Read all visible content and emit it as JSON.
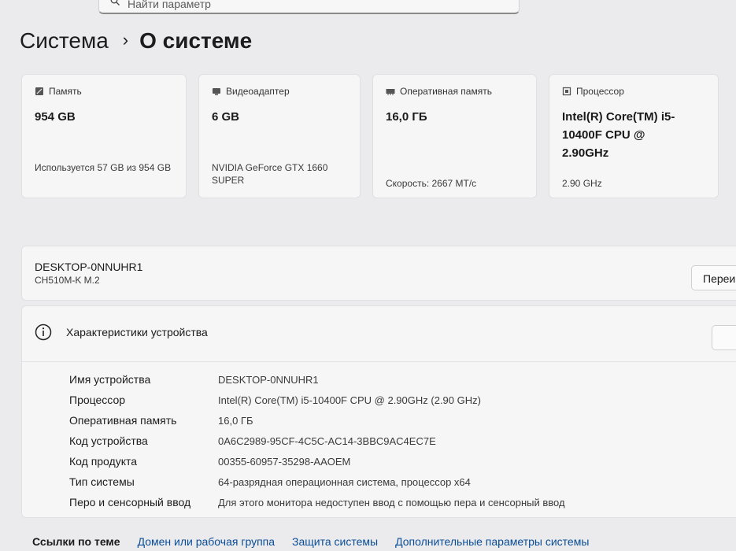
{
  "search": {
    "placeholder": "Найти параметр"
  },
  "breadcrumb": {
    "parent": "Система",
    "separator": "›",
    "current": "О системе"
  },
  "cards": [
    {
      "header": "Память",
      "icon": "storage-icon",
      "value": "954 GB",
      "sub": "Используется 57 GB из 954 GB"
    },
    {
      "header": "Видеоадаптер",
      "icon": "gpu-icon",
      "value": "6 GB",
      "sub": "NVIDIA GeForce GTX 1660 SUPER"
    },
    {
      "header": "Оперативная память",
      "icon": "ram-icon",
      "value": "16,0 ГБ",
      "sub": "Скорость: 2667 MT/с"
    },
    {
      "header": "Процессор",
      "icon": "cpu-icon",
      "value": "Intel(R) Core(TM) i5-10400F CPU @ 2.90GHz",
      "sub": "2.90 GHz"
    }
  ],
  "device": {
    "name": "DESKTOP-0NNUHR1",
    "model": "CH510M-K M.2",
    "rename_label": "Переи"
  },
  "specs": {
    "title": "Характеристики устройства",
    "rows": [
      {
        "key": "Имя устройства",
        "value": "DESKTOP-0NNUHR1"
      },
      {
        "key": "Процессор",
        "value": "Intel(R) Core(TM) i5-10400F CPU @ 2.90GHz (2.90 GHz)"
      },
      {
        "key": "Оперативная память",
        "value": "16,0 ГБ"
      },
      {
        "key": "Код устройства",
        "value": "0A6C2989-95CF-4C5C-AC14-3BBC9AC4EC7E"
      },
      {
        "key": "Код продукта",
        "value": "00355-60957-35298-AAOEM"
      },
      {
        "key": "Тип системы",
        "value": "64-разрядная операционная система, процессор x64"
      },
      {
        "key": "Перо и сенсорный ввод",
        "value": "Для этого монитора недоступен ввод с помощью пера и сенсорный ввод"
      }
    ]
  },
  "related": {
    "title": "Ссылки по теме",
    "links": [
      "Домен или рабочая группа",
      "Защита системы",
      "Дополнительные параметры системы"
    ]
  }
}
